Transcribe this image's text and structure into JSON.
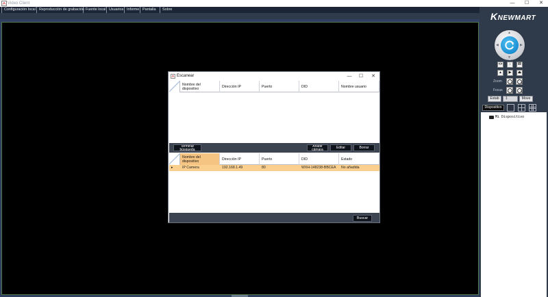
{
  "window": {
    "title": "Video Client",
    "minimize": "—",
    "maximize": "☐",
    "close": "✕"
  },
  "menu": [
    {
      "label": "Configuración local"
    },
    {
      "label": "Reproducción de grabación"
    },
    {
      "label": "Fuente local"
    },
    {
      "label": "Usuarios"
    },
    {
      "label": "Informe"
    },
    {
      "label": "Pantalla"
    },
    {
      "label": "Sobre"
    }
  ],
  "brand": {
    "k": "K",
    "rest": "NEWMART"
  },
  "ptz": {
    "buttons_row1": [
      "<>",
      "↕",
      "IR"
    ],
    "buttons_row2": [
      "▲",
      "▶",
      "⏏"
    ],
    "zoom_label": "Zoom",
    "focus_label": "Focus",
    "estab_label": "Estab",
    "preset_value": "1",
    "move_label": "Move"
  },
  "panel": {
    "dispositivo_tab": "Dispositivo",
    "tree_root": "Mi Dispositivo"
  },
  "dialog": {
    "title": "Escanear",
    "minimize": "—",
    "maximize": "☐",
    "close": "✕",
    "top_columns": [
      "Nombre del dispositivo",
      "Dirección IP",
      "Puerto",
      "DID",
      "Nombre usuario"
    ],
    "toolbar": {
      "stop_search": "Terminar búsqueda",
      "add_camera": "Añadir cámara",
      "edit": "Editar",
      "delete": "Borrar"
    },
    "bottom_columns": [
      "Nombre del dispositivo",
      "Dirección IP",
      "Puerto",
      "DID",
      "Estado"
    ],
    "rows": [
      {
        "marker": "▸",
        "name": "IP Camera",
        "ip": "192.168.1.49",
        "port": "80",
        "did": "WXH-148238-BBCEA",
        "status": "No añadida"
      }
    ],
    "search_button": "Buscar"
  },
  "colors": {
    "menubar": "#1c2535",
    "panel": "#2f3a4a",
    "selected_row": "#fbd08f",
    "selected_header": "#f6c482"
  }
}
